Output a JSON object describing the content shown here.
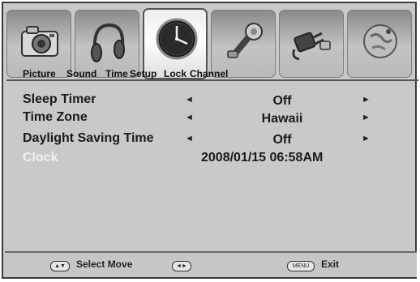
{
  "tabs": [
    {
      "label": "Picture",
      "icon": "camera-icon",
      "active": false
    },
    {
      "label": "Sound",
      "icon": "headphones-icon",
      "active": false
    },
    {
      "label": "Time",
      "icon": "clock-icon",
      "active": true
    },
    {
      "label": "Setup",
      "icon": "wrench-icon",
      "active": false
    },
    {
      "label": "Lock",
      "icon": "plug-icon",
      "active": false
    },
    {
      "label": "Channel",
      "icon": "satellite-globe-icon",
      "active": false
    }
  ],
  "settings": {
    "sleep_timer": {
      "label": "Sleep Timer",
      "value": "Off"
    },
    "time_zone": {
      "label": "Time Zone",
      "value": "Hawaii"
    },
    "daylight_saving": {
      "label": "Daylight Saving Time",
      "value": "Off"
    },
    "clock": {
      "label": "Clock",
      "value": "2008/01/15  06:58AM"
    }
  },
  "footer": {
    "select_move": "Select Move",
    "menu_button": "MENU",
    "exit": "Exit"
  },
  "arrows": {
    "left": "◄",
    "right": "►"
  }
}
